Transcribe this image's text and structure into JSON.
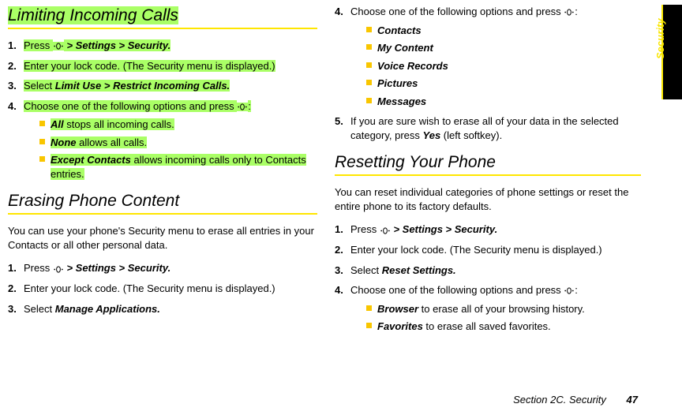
{
  "tab": {
    "label": "Security"
  },
  "footer": {
    "section": "Section 2C. Security",
    "page": "47"
  },
  "left": {
    "title1": "Limiting Incoming Calls",
    "steps1": {
      "s1_a": "Press ",
      "s1_b": " > Settings > Security.",
      "s2": "Enter your lock code. (The Security menu is displayed.)",
      "s3_a": "Select ",
      "s3_b": "Limit Use > Restrict Incoming Calls.",
      "s4_a": "Choose one of the following options and press ",
      "s4_b": ":"
    },
    "sub1": {
      "a_b": "All",
      "a_t": " stops all incoming calls.",
      "b_b": "None",
      "b_t": " allows all calls.",
      "c_b": "Except Contacts",
      "c_t": " allows incoming calls only to Contacts entries."
    },
    "title2": "Erasing Phone Content",
    "body2": "You can use your phone's Security menu to erase all entries in your Contacts or all other personal data.",
    "steps2": {
      "s1_a": "Press ",
      "s1_b": " > Settings > Security.",
      "s2": "Enter your lock code. (The Security menu is displayed.)",
      "s3_a": "Select ",
      "s3_b": "Manage Applications."
    }
  },
  "right": {
    "steps_top": {
      "s4_a": "Choose one of the following options and press ",
      "s4_b": ":"
    },
    "sub_top": {
      "a": "Contacts",
      "b": "My Content",
      "c": "Voice Records",
      "d": "Pictures",
      "e": "Messages"
    },
    "s5_a": "If you are sure wish to erase all of your data in the selected category, press ",
    "s5_yes": "Yes",
    "s5_b": " (left softkey).",
    "title3": "Resetting Your Phone",
    "body3": "You can reset individual categories of phone settings or reset the entire phone to its factory defaults.",
    "steps3": {
      "s1_a": "Press ",
      "s1_b": " > Settings > Security.",
      "s2": "Enter your lock code. (The Security menu is displayed.)",
      "s3_a": "Select ",
      "s3_b": "Reset Settings.",
      "s4_a": "Choose one of the following options and press ",
      "s4_b": ":"
    },
    "sub3": {
      "a_b": "Browser",
      "a_t": " to erase all of your browsing history.",
      "b_b": "Favorites",
      "b_t": " to erase all saved favorites."
    }
  }
}
